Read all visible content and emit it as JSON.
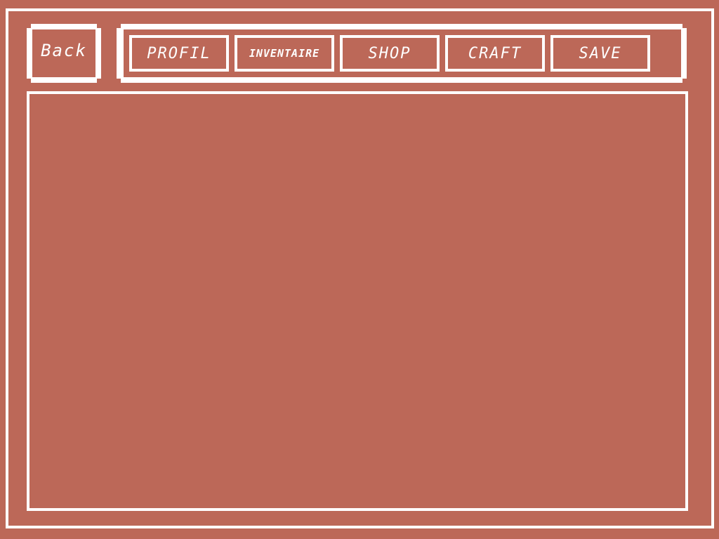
{
  "back_button": {
    "label": "Back"
  },
  "nav": {
    "tabs": [
      {
        "label": "PROFIL"
      },
      {
        "label": "INVENTAIRE"
      },
      {
        "label": "SHOP"
      },
      {
        "label": "CRAFT"
      },
      {
        "label": "SAVE"
      }
    ]
  },
  "colors": {
    "background": "#bc6858",
    "border": "#ffffff",
    "text": "#ffffff"
  }
}
